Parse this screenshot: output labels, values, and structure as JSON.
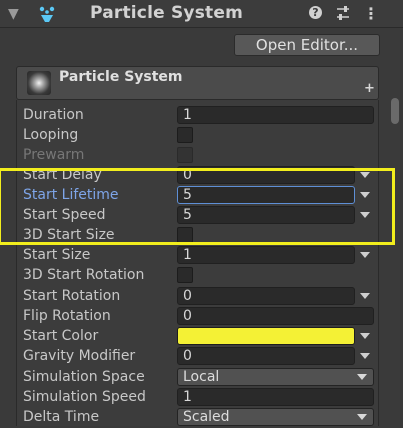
{
  "header": {
    "title": "Particle System",
    "help_glyph": "?",
    "kebab_glyph": "⋮",
    "fold_glyph": "▼"
  },
  "toolbar": {
    "open_editor_label": "Open Editor..."
  },
  "module": {
    "label": "Particle System",
    "add_glyph": "+"
  },
  "properties": {
    "duration": {
      "label": "Duration",
      "value": "1"
    },
    "looping": {
      "label": "Looping",
      "checked": false
    },
    "prewarm": {
      "label": "Prewarm",
      "checked": false,
      "disabled": true
    },
    "start_delay": {
      "label": "Start Delay",
      "value": "0"
    },
    "start_lifetime": {
      "label": "Start Lifetime",
      "value": "5"
    },
    "start_speed": {
      "label": "Start Speed",
      "value": "5"
    },
    "start_size_3d": {
      "label": "3D Start Size",
      "checked": false
    },
    "start_size": {
      "label": "Start Size",
      "value": "1"
    },
    "start_rotation_3d": {
      "label": "3D Start Rotation",
      "checked": false
    },
    "start_rotation": {
      "label": "Start Rotation",
      "value": "0"
    },
    "flip_rotation": {
      "label": "Flip Rotation",
      "value": "0"
    },
    "start_color": {
      "label": "Start Color",
      "color": "#f4f135"
    },
    "gravity_modifier": {
      "label": "Gravity Modifier",
      "value": "0"
    },
    "simulation_space": {
      "label": "Simulation Space",
      "value": "Local"
    },
    "simulation_speed": {
      "label": "Simulation Speed",
      "value": "1"
    },
    "delta_time": {
      "label": "Delta Time",
      "value": "Scaled"
    }
  },
  "theme": {
    "highlight_color": "#f2ee1d",
    "focus_color": "#5e8fd6",
    "background": "#3c3c3c"
  }
}
